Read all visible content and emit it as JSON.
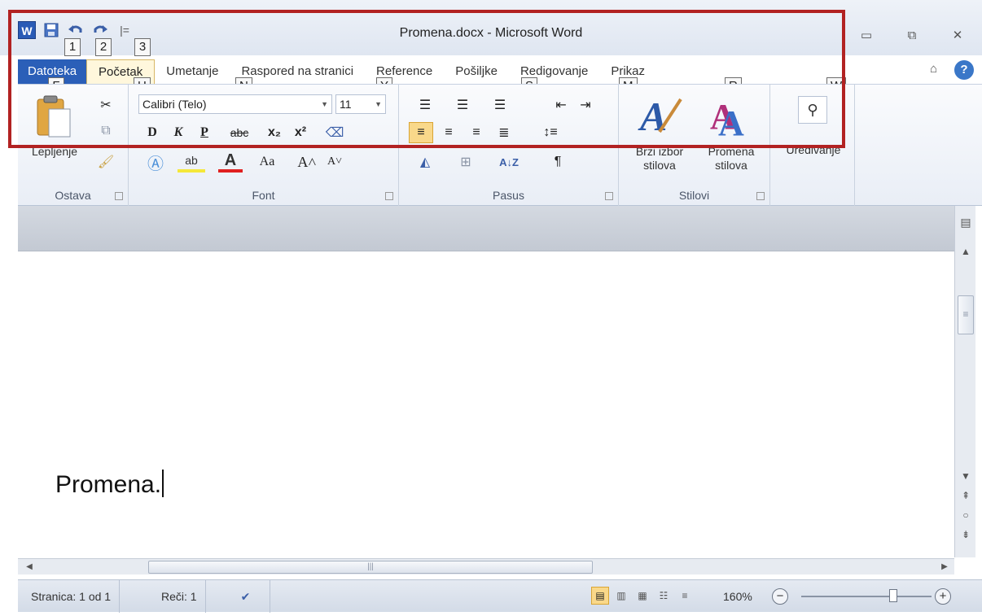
{
  "window": {
    "title": "Promena.docx - Microsoft Word",
    "app_logo": "W",
    "minimize": "▭",
    "restore": "⧉",
    "close": "✕"
  },
  "qat": {
    "keytips": [
      "1",
      "2",
      "3"
    ],
    "more": "|="
  },
  "tabs": [
    {
      "label": "Datoteka",
      "keytip": "F"
    },
    {
      "label": "Početak",
      "keytip": "H"
    },
    {
      "label": "Umetanje",
      "keytip": "N"
    },
    {
      "label": "Raspored na stranici",
      "keytip": "Y"
    },
    {
      "label": "Reference",
      "keytip": "S"
    },
    {
      "label": "Pošiljke",
      "keytip": "M"
    },
    {
      "label": "Redigovanje",
      "keytip": "R"
    },
    {
      "label": "Prikaz",
      "keytip": "W"
    }
  ],
  "help": "?",
  "ribbon": {
    "clipboard": {
      "label": "Ostava",
      "paste_label": "Lepljenje"
    },
    "font": {
      "label": "Font",
      "font_name": "Calibri (Telo)",
      "font_size": "11",
      "bold": "D",
      "italic": "K",
      "underline": "P",
      "strike": "abc",
      "subscript": "x₂",
      "superscript": "x²",
      "grow": "A˄",
      "shrink": "A˅",
      "case": "Aa"
    },
    "paragraph": {
      "label": "Pasus",
      "pilcrow": "¶"
    },
    "styles": {
      "label": "Stilovi",
      "quick_styles": "Brzi izbor stilova",
      "change_styles": "Promena stilova"
    },
    "editing": {
      "label": "Uređivanje"
    }
  },
  "document": {
    "text": "Promena."
  },
  "status": {
    "page": "Stranica: 1 od 1",
    "words": "Reči: 1",
    "zoom": "160%",
    "zoom_level_fraction": 0.72
  }
}
